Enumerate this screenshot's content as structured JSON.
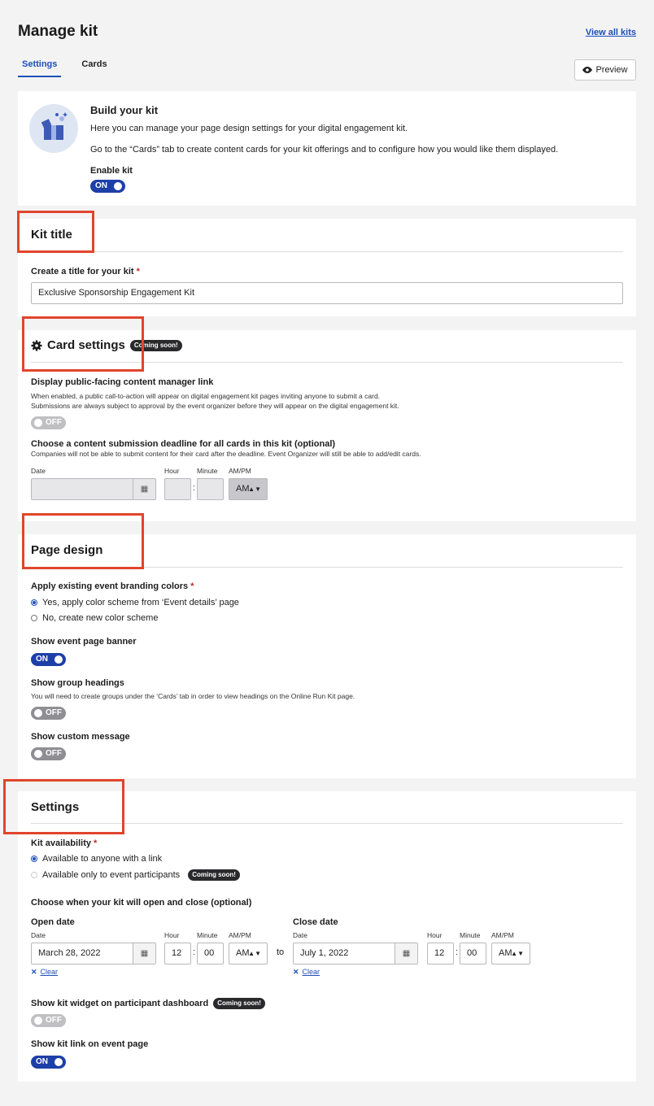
{
  "header": {
    "title": "Manage kit",
    "view_all": "View all kits",
    "preview": "Preview"
  },
  "tabs": [
    {
      "label": "Settings"
    },
    {
      "label": "Cards"
    }
  ],
  "build": {
    "title": "Build your kit",
    "desc1": "Here you can manage your page design settings for your digital engagement kit.",
    "desc2": "Go to the “Cards” tab to create content cards for your kit offerings and to configure how you would like them displayed.",
    "enable_label": "Enable kit",
    "enable_state": "ON"
  },
  "kit_title": {
    "heading": "Kit title",
    "label": "Create a title for your kit",
    "required": "*",
    "value": "Exclusive Sponsorship Engagement Kit"
  },
  "card_settings": {
    "heading": "Card settings",
    "badge": "Coming soon!",
    "public_label": "Display public-facing content manager link",
    "public_help1": "When enabled, a public call-to-action will appear on digital engagement kit pages inviting anyone to submit a card.",
    "public_help2": "Submissions are always subject to approval by the event organizer before they will appear on the digital engagement kit.",
    "public_state": "OFF",
    "deadline_label": "Choose a content submission deadline for all cards in this kit (optional)",
    "deadline_help": "Companies will not be able to submit content for their card after the deadline. Event Organizer will still be able to add/edit cards.",
    "date_label": "Date",
    "hour_label": "Hour",
    "minute_label": "Minute",
    "ampm_label": "AM/PM",
    "ampm_value": "AM"
  },
  "page_design": {
    "heading": "Page design",
    "branding_label": "Apply existing event branding colors",
    "required": "*",
    "option_yes": "Yes, apply color scheme from ‘Event details’ page",
    "option_no": "No, create new color scheme",
    "banner_label": "Show event page banner",
    "banner_state": "ON",
    "group_label": "Show group headings",
    "group_help": "You will need to create groups under the ‘Cards’ tab in order to view headings on the Online Run Kit page.",
    "group_state": "OFF",
    "custom_label": "Show custom message",
    "custom_state": "OFF"
  },
  "settings": {
    "heading": "Settings",
    "availability_label": "Kit availability",
    "required": "*",
    "option_anyone": "Available to anyone with a link",
    "option_participants": "Available only to event participants",
    "badge": "Coming soon!",
    "open_close_label": "Choose when your kit will open and close (optional)",
    "open": {
      "title": "Open date",
      "date_label": "Date",
      "date_value": "March 28, 2022",
      "hour": "12",
      "minute": "00",
      "ampm": "AM",
      "clear": "Clear"
    },
    "to": "to",
    "close": {
      "title": "Close date",
      "date_label": "Date",
      "date_value": "July 1, 2022",
      "hour": "12",
      "minute": "00",
      "ampm": "AM",
      "clear": "Clear"
    },
    "hour_label": "Hour",
    "minute_label": "Minute",
    "ampm_label": "AM/PM",
    "widget_label": "Show kit widget on participant dashboard",
    "widget_state": "OFF",
    "link_label": "Show kit link on event page",
    "link_state": "ON"
  },
  "colors": {
    "accent": "#1d4fb8",
    "toggle_on": "#1d3fa8",
    "toggle_off": "#8e8e93",
    "highlight": "#e0452c",
    "required": "#c62828"
  }
}
